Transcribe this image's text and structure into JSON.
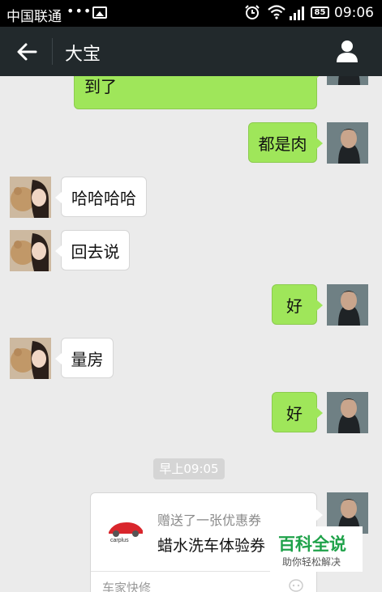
{
  "status_bar": {
    "carrier": "中国联通",
    "dots": "•••",
    "battery": "85",
    "time": "09:06"
  },
  "nav": {
    "title": "大宝"
  },
  "messages": [
    {
      "from": "me",
      "text": "到了"
    },
    {
      "from": "me",
      "text": "都是肉"
    },
    {
      "from": "other",
      "text": "哈哈哈哈"
    },
    {
      "from": "other",
      "text": "回去说"
    },
    {
      "from": "me",
      "text": "好"
    },
    {
      "from": "other",
      "text": "量房"
    },
    {
      "from": "me",
      "text": "好"
    }
  ],
  "timestamp": "早上09:05",
  "coupon": {
    "subtitle": "赠送了一张优惠券",
    "title": "蜡水洗车体验券",
    "logo_text": "carplus",
    "source": "车家快修"
  },
  "watermark": {
    "title": "百科全说",
    "subtitle": "助你轻松解决"
  },
  "colors": {
    "my_bubble": "#9fe65a",
    "nav_bg": "#22292c",
    "chat_bg": "#ebebeb"
  }
}
